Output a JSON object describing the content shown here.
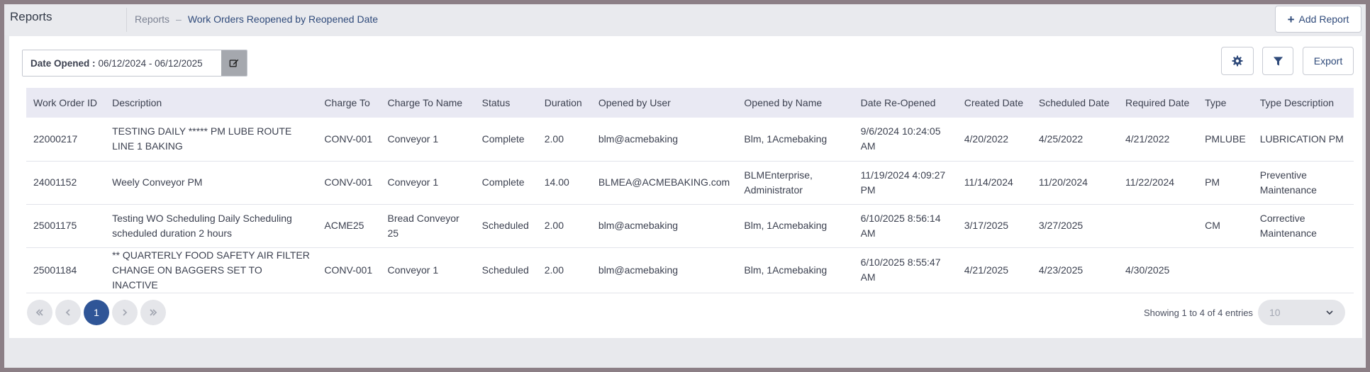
{
  "app": {
    "title": "Reports"
  },
  "breadcrumb": {
    "root": "Reports",
    "separator": "–",
    "current": "Work Orders Reopened by Reopened Date"
  },
  "header": {
    "add_report_label": "Add Report"
  },
  "filter": {
    "label": "Date Opened :",
    "value": "06/12/2024 - 06/12/2025"
  },
  "toolbar": {
    "export_label": "Export",
    "settings_icon": "gear-icon",
    "filter_icon": "funnel-icon"
  },
  "table": {
    "columns": [
      "Work Order ID",
      "Description",
      "Charge To",
      "Charge To Name",
      "Status",
      "Duration",
      "Opened by User",
      "Opened by Name",
      "Date Re-Opened",
      "Created Date",
      "Scheduled Date",
      "Required Date",
      "Type",
      "Type Description"
    ],
    "rows": [
      [
        "22000217",
        "TESTING DAILY ***** PM LUBE ROUTE LINE 1 BAKING",
        "CONV-001",
        "Conveyor 1",
        "Complete",
        "2.00",
        "blm@acmebaking",
        "Blm, 1Acmebaking",
        "9/6/2024 10:24:05 AM",
        "4/20/2022",
        "4/25/2022",
        "4/21/2022",
        "PMLUBE",
        "LUBRICATION PM"
      ],
      [
        "24001152",
        "Weely Conveyor PM",
        "CONV-001",
        "Conveyor 1",
        "Complete",
        "14.00",
        "BLMEA@ACMEBAKING.com",
        "BLMEnterprise, Administrator",
        "11/19/2024 4:09:27 PM",
        "11/14/2024",
        "11/20/2024",
        "11/22/2024",
        "PM",
        "Preventive Maintenance"
      ],
      [
        "25001175",
        "Testing WO Scheduling Daily Scheduling scheduled duration 2 hours",
        "ACME25",
        "Bread Conveyor 25",
        "Scheduled",
        "2.00",
        "blm@acmebaking",
        "Blm, 1Acmebaking",
        "6/10/2025 8:56:14 AM",
        "3/17/2025",
        "3/27/2025",
        "",
        "CM",
        "Corrective Maintenance"
      ],
      [
        "25001184",
        "** QUARTERLY FOOD SAFETY AIR FILTER CHANGE ON BAGGERS SET TO INACTIVE",
        "CONV-001",
        "Conveyor 1",
        "Scheduled",
        "2.00",
        "blm@acmebaking",
        "Blm, 1Acmebaking",
        "6/10/2025 8:55:47 AM",
        "4/21/2025",
        "4/23/2025",
        "4/30/2025",
        "",
        ""
      ]
    ]
  },
  "pagination": {
    "current_page": "1",
    "summary": "Showing 1 to 4 of 4 entries",
    "page_size": "10"
  },
  "colors": {
    "accent": "#2f5597",
    "header_bg": "#e9e9f3"
  }
}
